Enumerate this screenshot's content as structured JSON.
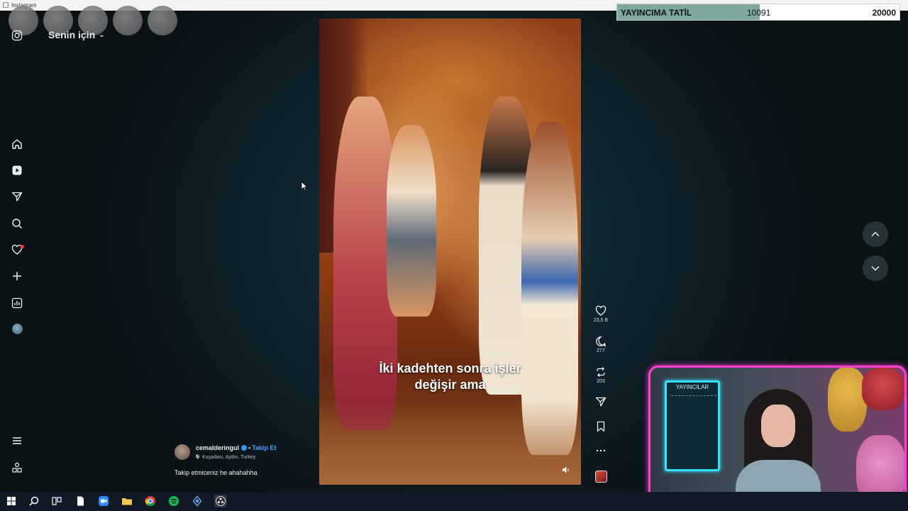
{
  "window": {
    "title": "Instagram"
  },
  "goal_bar": {
    "label": "YAYINCIMA TATİL",
    "current": "10091",
    "target": "20000",
    "progress": 0.505,
    "fill_color": "#7fa8a1"
  },
  "header": {
    "feed_label": "Senin için"
  },
  "sidebar": {
    "top_icon": "instagram-icon",
    "items": [
      "home-icon",
      "reels-icon",
      "direct-icon",
      "search-icon",
      "notifications-icon",
      "create-icon",
      "dashboard-icon",
      "profile-avatar"
    ],
    "bottom_items": [
      "menu-icon",
      "apps-icon"
    ],
    "notification_dot_color": "#ff3040"
  },
  "video": {
    "subtitle_line1": "İki kadehten sonra işler",
    "subtitle_line2": "değişir ama"
  },
  "actions": {
    "likes": "23,5 B",
    "comments": "277",
    "reposts": "203"
  },
  "post": {
    "username": "cemalderingul",
    "follow_label": "Takip Et",
    "location": "Kuşadası, Aydın, Turkey",
    "caption": "Takip etmiceniz he ahahahha"
  },
  "webcam": {
    "board_title": "YAYINCILAR",
    "frame_color": "#ff3fd0"
  },
  "taskbar": {
    "apps": [
      "windows-start-icon",
      "search-icon",
      "task-view-icon",
      "file-icon",
      "zoom-icon",
      "file-explorer-icon",
      "chrome-icon",
      "spotify-icon",
      "app-icon",
      "obs-icon"
    ]
  }
}
